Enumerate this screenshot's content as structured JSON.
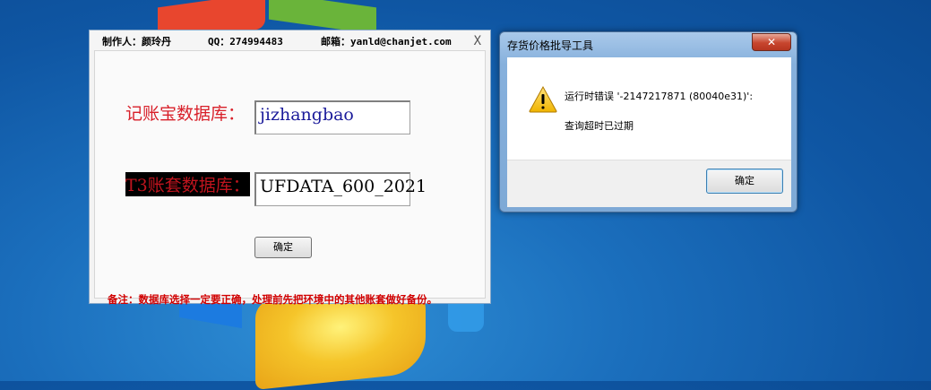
{
  "main_window": {
    "author": "制作人：颜玲丹",
    "qq": "QQ：274994483",
    "email": "邮箱：yanld@chanjet.com",
    "close_glyph": "X",
    "jizhangbao_label": "记账宝数据库：",
    "jizhangbao_value": "jizhangbao",
    "t3_label": "T3账套数据库：",
    "t3_value": "UFDATA_600_2021",
    "ok_label": "确定",
    "note": "备注：数据库选择一定要正确，处理前先把环境中的其他账套做好备份。"
  },
  "error_dialog": {
    "title": "存货价格批导工具",
    "close_glyph": "✕",
    "message_line1": "运行时错误 '-2147217871 (80040e31)':",
    "message_line2": "查询超时已过期",
    "ok_label": "确定"
  }
}
